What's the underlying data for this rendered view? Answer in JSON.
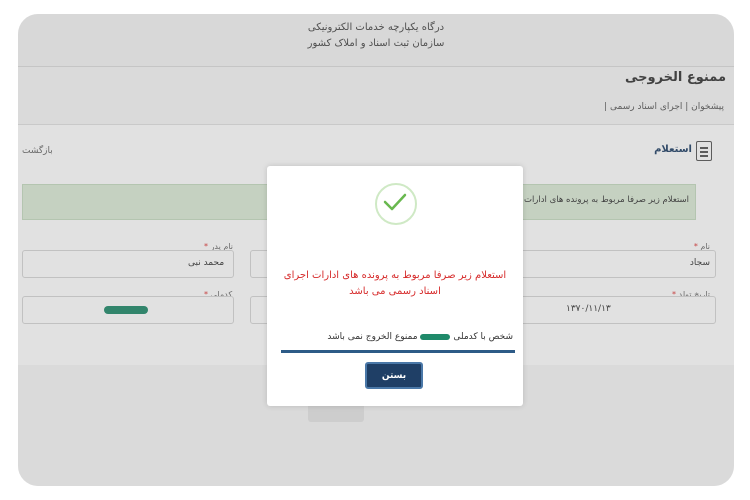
{
  "header": {
    "portal_title": "درگاه یکپارچه خدمات الکترونیکی",
    "portal_subtitle": "سازمان ثبت اسناد و املاک کشور"
  },
  "page": {
    "title": "ممنوع الخروجی",
    "breadcrumb": "پیشخوان | اجرای اسناد رسمی |"
  },
  "card": {
    "title": "استعلام",
    "back_label": "بازگشت",
    "alert": "استعلام زیر صرفا مربوط به پرونده های ادارات اجرا..."
  },
  "form": {
    "first_name": {
      "label": "نام",
      "value": "سجاد"
    },
    "father_name": {
      "label": "نام پدر",
      "value": "محمد نبی"
    },
    "birth_date": {
      "label": "تاریخ تولد",
      "value": "۱۳۷۰/۱۱/۱۳"
    },
    "national_id": {
      "label": "کدملی",
      "value": ""
    }
  },
  "modal": {
    "message": "استعلام زیر صرفا مربوط به پرونده های ادارات اجرای اسناد رسمی می باشد",
    "result_prefix": "شخص با کدملی",
    "result_suffix": "ممنوع الخروج نمی باشد",
    "close_label": "بستن"
  },
  "colors": {
    "accent_navy": "#1f3f66",
    "alert_red": "#d62a2a",
    "success_green": "#69b84f",
    "alert_strip_bg": "#dcebd7"
  },
  "icons": {
    "success": "check-circle-icon",
    "document": "document-icon"
  }
}
